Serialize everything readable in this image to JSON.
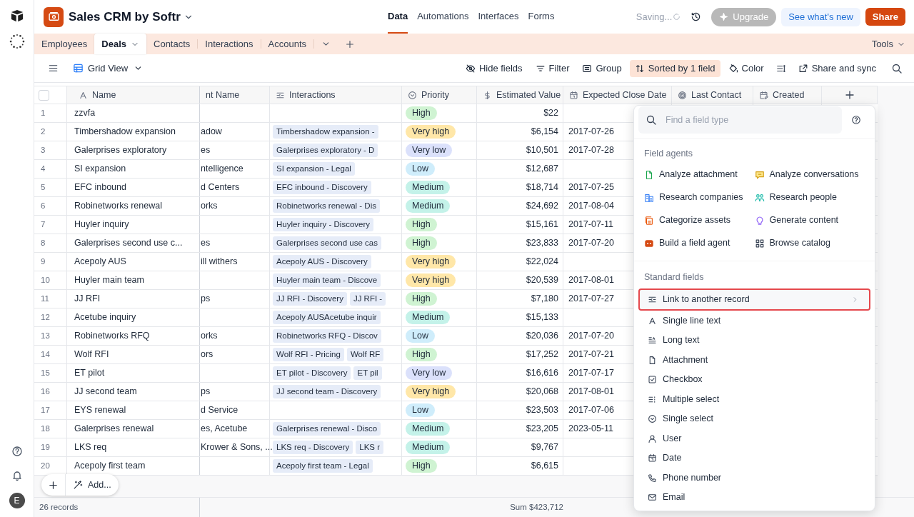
{
  "app": {
    "title": "Sales CRM by Softr"
  },
  "nav": [
    {
      "label": "Data",
      "selected": true
    },
    {
      "label": "Automations",
      "selected": false
    },
    {
      "label": "Interfaces",
      "selected": false
    },
    {
      "label": "Forms",
      "selected": false
    }
  ],
  "status": "Saving...",
  "buttons": {
    "upgrade": "Upgrade",
    "whats_new": "See what's new",
    "share": "Share"
  },
  "tabs": [
    {
      "label": "Employees",
      "selected": false
    },
    {
      "label": "Deals",
      "selected": true
    },
    {
      "label": "Contacts",
      "selected": false
    },
    {
      "label": "Interactions",
      "selected": false
    },
    {
      "label": "Accounts",
      "selected": false
    }
  ],
  "tools": "Tools",
  "view": {
    "name": "Grid View"
  },
  "toolbar": [
    {
      "label": "Hide fields",
      "on": false
    },
    {
      "label": "Filter",
      "on": false
    },
    {
      "label": "Group",
      "on": false
    },
    {
      "label": "Sorted by 1 field",
      "on": true
    },
    {
      "label": "Color",
      "on": false
    },
    {
      "label": "Share and sync",
      "on": false
    }
  ],
  "table": {
    "select_all": {
      "checked": false
    },
    "columns": [
      {
        "label": "Name"
      },
      {
        "label": "nt Name"
      },
      {
        "label": "Interactions"
      },
      {
        "label": "Priority"
      },
      {
        "label": "Estimated Value"
      },
      {
        "label": "Expected Close Date"
      },
      {
        "label": "Last Contact"
      },
      {
        "label": "Created"
      }
    ],
    "rows": [
      {
        "number": "1",
        "name": "zzvfa",
        "priority": {
          "label": "High",
          "color": "#cff3d2"
        },
        "estimated_value": "$22"
      },
      {
        "number": "2",
        "name": "Timbershadow expansion",
        "column_2": "adow",
        "interactions": [
          "Timbershadow expansion -"
        ],
        "priority": {
          "label": "Very high",
          "color": "#ffe7a8"
        },
        "estimated_value": "$6,154",
        "expected_close_date": "2017-07-26"
      },
      {
        "number": "3",
        "name": "Galerprises exploratory",
        "column_2": "es",
        "interactions": [
          "Galerprises exploratory - D"
        ],
        "priority": {
          "label": "Very low",
          "color": "#dbe1fb"
        },
        "estimated_value": "$10,501",
        "expected_close_date": "2017-07-28"
      },
      {
        "number": "4",
        "name": "SI expansion",
        "column_2": "ntelligence",
        "interactions": [
          "SI expansion - Legal"
        ],
        "priority": {
          "label": "Low",
          "color": "#cfedfb"
        },
        "estimated_value": "$12,687"
      },
      {
        "number": "5",
        "name": "EFC inbound",
        "column_2": "d Centers",
        "interactions": [
          "EFC inbound - Discovery"
        ],
        "priority": {
          "label": "Medium",
          "color": "#c4f2e9"
        },
        "estimated_value": "$18,714",
        "expected_close_date": "2017-07-25"
      },
      {
        "number": "6",
        "name": "Robinetworks renewal",
        "column_2": "orks",
        "interactions": [
          "Robinetworks renewal - Dis"
        ],
        "priority": {
          "label": "Medium",
          "color": "#c4f2e9"
        },
        "estimated_value": "$24,692",
        "expected_close_date": "2017-08-04"
      },
      {
        "number": "7",
        "name": "Huyler inquiry",
        "interactions": [
          "Huyler inquiry - Discovery"
        ],
        "priority": {
          "label": "High",
          "color": "#cff3d2"
        },
        "estimated_value": "$15,161",
        "expected_close_date": "2017-07-11"
      },
      {
        "number": "8",
        "name": "Galerprises second use c...",
        "column_2": "es",
        "interactions": [
          "Galerprises second use cas"
        ],
        "priority": {
          "label": "High",
          "color": "#cff3d2"
        },
        "estimated_value": "$23,833",
        "expected_close_date": "2017-07-20"
      },
      {
        "number": "9",
        "name": "Acepoly AUS",
        "column_2": "ill withers",
        "interactions": [
          "Acepoly AUS - Discovery"
        ],
        "priority": {
          "label": "Very high",
          "color": "#ffe7a8"
        },
        "estimated_value": "$22,024"
      },
      {
        "number": "10",
        "name": "Huyler main team",
        "interactions": [
          "Huyler main team - Discove"
        ],
        "priority": {
          "label": "Very high",
          "color": "#ffe7a8"
        },
        "estimated_value": "$20,539",
        "expected_close_date": "2017-08-01"
      },
      {
        "number": "11",
        "name": "JJ RFI",
        "column_2": "ps",
        "interactions": [
          "JJ RFI - Discovery",
          "JJ RFI -"
        ],
        "priority": {
          "label": "High",
          "color": "#cff3d2"
        },
        "estimated_value": "$7,180",
        "expected_close_date": "2017-07-27"
      },
      {
        "number": "12",
        "name": "Acetube inquiry",
        "interactions": [
          "Acepoly AUSAcetube inquir"
        ],
        "priority": {
          "label": "Medium",
          "color": "#c4f2e9"
        },
        "estimated_value": "$15,133"
      },
      {
        "number": "13",
        "name": "Robinetworks RFQ",
        "column_2": "orks",
        "interactions": [
          "Robinetworks RFQ - Discov"
        ],
        "priority": {
          "label": "Low",
          "color": "#cfedfb"
        },
        "estimated_value": "$20,036",
        "expected_close_date": "2017-07-20"
      },
      {
        "number": "14",
        "name": "Wolf RFI",
        "column_2": "ors",
        "interactions": [
          "Wolf RFI - Pricing",
          "Wolf RF"
        ],
        "priority": {
          "label": "High",
          "color": "#cff3d2"
        },
        "estimated_value": "$17,252",
        "expected_close_date": "2017-07-21"
      },
      {
        "number": "15",
        "name": "ET pilot",
        "interactions": [
          "ET pilot - Discovery",
          "ET pil"
        ],
        "priority": {
          "label": "Very low",
          "color": "#dbe1fb"
        },
        "estimated_value": "$16,616",
        "expected_close_date": "2017-07-17"
      },
      {
        "number": "16",
        "name": "JJ second team",
        "column_2": "ps",
        "interactions": [
          "JJ second team - Discovery"
        ],
        "priority": {
          "label": "Very high",
          "color": "#ffe7a8"
        },
        "estimated_value": "$20,068",
        "expected_close_date": "2017-08-01"
      },
      {
        "number": "17",
        "name": "EYS renewal",
        "column_2": "d Service",
        "priority": {
          "label": "Low",
          "color": "#cfedfb"
        },
        "estimated_value": "$23,503",
        "expected_close_date": "2017-07-06"
      },
      {
        "number": "18",
        "name": "Galerprises renewal",
        "column_2": "es, Acetube",
        "interactions": [
          "Galerprises renewal - Disco"
        ],
        "priority": {
          "label": "Medium",
          "color": "#c4f2e9"
        },
        "estimated_value": "$23,205",
        "expected_close_date": "2023-05-11"
      },
      {
        "number": "19",
        "name": "LKS req",
        "column_2": "Krower & Sons, ...",
        "interactions": [
          "LKS req - Discovery",
          "LKS r"
        ],
        "priority": {
          "label": "Medium",
          "color": "#c4f2e9"
        },
        "estimated_value": "$9,767"
      },
      {
        "number": "20",
        "name": "Acepoly first team",
        "interactions": [
          "Acepoly first team - Legal"
        ],
        "priority": {
          "label": "High",
          "color": "#cff3d2"
        },
        "estimated_value": "$6,615"
      }
    ]
  },
  "footer": {
    "records": "26 records",
    "sum": "Sum $423,712"
  },
  "add_bar": {
    "label": "Add..."
  },
  "field_menu": {
    "search_placeholder": "Find a field type",
    "agents_title": "Field agents",
    "agents": [
      "Analyze attachment",
      "Analyze conversations",
      "Research companies",
      "Research people",
      "Categorize assets",
      "Generate content",
      "Build a field agent",
      "Browse catalog"
    ],
    "standard_title": "Standard fields",
    "standard": [
      {
        "label": "Link to another record",
        "selected": true,
        "has_submenu": true
      },
      {
        "label": "Single line text",
        "selected": false,
        "has_submenu": false
      },
      {
        "label": "Long text",
        "selected": false,
        "has_submenu": false
      },
      {
        "label": "Attachment",
        "selected": false,
        "has_submenu": false
      },
      {
        "label": "Checkbox",
        "selected": false,
        "has_submenu": false
      },
      {
        "label": "Multiple select",
        "selected": false,
        "has_submenu": false
      },
      {
        "label": "Single select",
        "selected": false,
        "has_submenu": false
      },
      {
        "label": "User",
        "selected": false,
        "has_submenu": false
      },
      {
        "label": "Date",
        "selected": false,
        "has_submenu": false
      },
      {
        "label": "Phone number",
        "selected": false,
        "has_submenu": false
      },
      {
        "label": "Email",
        "selected": false,
        "has_submenu": false
      }
    ]
  },
  "user": {
    "initial": "E"
  }
}
